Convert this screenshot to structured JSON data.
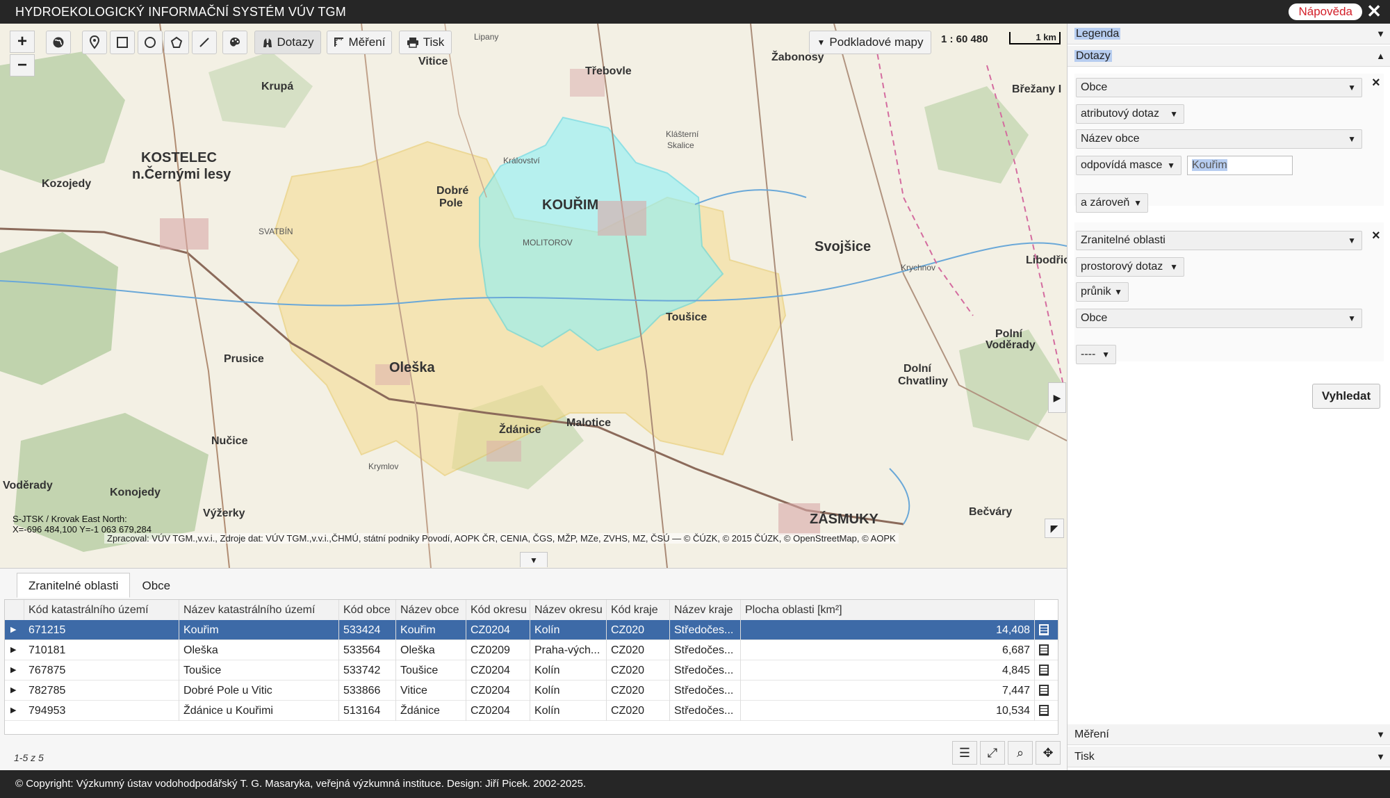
{
  "app": {
    "title": "HYDROEKOLOGICKÝ INFORMAČNÍ SYSTÉM VÚV TGM",
    "help_label": "Nápověda",
    "close_label": "✕"
  },
  "toolbar": {
    "zoom_in": "+",
    "zoom_out": "−",
    "queries_label": "Dotazy",
    "measure_label": "Měření",
    "print_label": "Tisk",
    "basemaps_label": "Podkladové mapy"
  },
  "map": {
    "scale_text": "1 : 60 480",
    "scale_bar_label": "1 km",
    "crs_text": "S-JTSK / Krovak East North:",
    "coords_text": "X=-696 484,100 Y=-1 063 679,284",
    "attribution": "Zpracoval: VÚV TGM.,v.v.i., Zdroje dat: VÚV TGM.,v.v.i.,ČHMÚ, státní podniky Povodí, AOPK ČR, CENIA, ČGS, MŽP, MZe, ZVHS, MZ, ČSÚ — © ČÚZK, © 2015 ČÚZK, © OpenStreetMap, © AOPK",
    "labels": {
      "kourim": "KOUŘIM",
      "kostelec": "KOSTELEC",
      "kostelec2": "n.Černými lesy",
      "kozojedy": "Kozojedy",
      "krupa": "Krupá",
      "trebovle": "Třebovle",
      "vitice": "Vitice",
      "dobrepole": "Dobré",
      "dobrepole2": "Pole",
      "oleska": "Oleška",
      "zdanice": "Ždánice",
      "malotice": "Malotice",
      "tousice": "Toušice",
      "svojsice": "Svojšice",
      "zasmuky": "ZÁSMUKY",
      "becvary": "Bečváry",
      "nucice": "Nučice",
      "konojedy": "Konojedy",
      "voderady": "Voděrady",
      "vyzerky": "Výžerky",
      "zabonosy": "Žabonosy",
      "brezany": "Břežany I",
      "polnivoderady": "Polní",
      "polnivoderady2": "Voděrady",
      "dolnichvatliny": "Dolní",
      "dolnichvatliny2": "Chvatliny",
      "klasterniskalice": "Klášterní",
      "klasterniskalice2": "Skalice",
      "prusice": "Prusice",
      "molitorov": "MOLITOROV",
      "krymlov": "Krymlov",
      "libodrice": "Libodřice",
      "krychnov": "Krychnov",
      "kralovstvi": "Království",
      "svatbin": "SVATBÍN",
      "lipany": "Lipany"
    }
  },
  "panel": {
    "legend_label": "Legenda",
    "queries_label": "Dotazy",
    "measure_label": "Měření",
    "print_label": "Tisk",
    "q1": {
      "layer": "Obce",
      "query_type": "atributový dotaz",
      "field": "Název obce",
      "operator": "odpovídá masce",
      "value": "Kouřim"
    },
    "join": "a zároveň",
    "q2": {
      "layer": "Zranitelné oblasti",
      "query_type": "prostorový dotaz",
      "operator": "průnik",
      "target": "Obce"
    },
    "next": "----",
    "search_label": "Vyhledat"
  },
  "results": {
    "tabs": [
      "Zranitelné oblasti",
      "Obce"
    ],
    "columns": [
      "Kód katastrálního území",
      "Název katastrálního území",
      "Kód obce",
      "Název obce",
      "Kód okresu",
      "Název okresu",
      "Kód kraje",
      "Název kraje",
      "Plocha oblasti [km²]"
    ],
    "rows": [
      [
        "671215",
        "Kouřim",
        "533424",
        "Kouřim",
        "CZ0204",
        "Kolín",
        "CZ020",
        "Středočes...",
        "14,408"
      ],
      [
        "710181",
        "Oleška",
        "533564",
        "Oleška",
        "CZ0209",
        "Praha-vých...",
        "CZ020",
        "Středočes...",
        "6,687"
      ],
      [
        "767875",
        "Toušice",
        "533742",
        "Toušice",
        "CZ0204",
        "Kolín",
        "CZ020",
        "Středočes...",
        "4,845"
      ],
      [
        "782785",
        "Dobré Pole u Vitic",
        "533866",
        "Vitice",
        "CZ0204",
        "Kolín",
        "CZ020",
        "Středočes...",
        "7,447"
      ],
      [
        "794953",
        "Ždánice u Kouřimi",
        "513164",
        "Ždánice",
        "CZ0204",
        "Kolín",
        "CZ020",
        "Středočes...",
        "10,534"
      ]
    ],
    "pager": "1-5 z 5"
  },
  "footer": {
    "copyright": "© Copyright: Výzkumný ústav vodohodpodářský T. G. Masaryka, veřejná výzkumná instituce. Design: Jiří Picek. 2002-2025."
  }
}
